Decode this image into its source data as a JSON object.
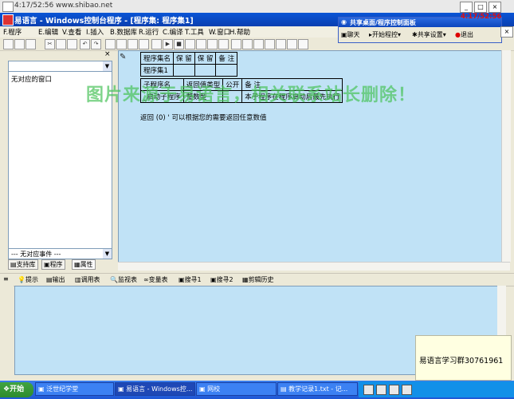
{
  "recorder": {
    "title": "4:17/52:56 www.shibao.net"
  },
  "window": {
    "title": "易语言 - Windows控制台程序 - [程序集: 程序集1]"
  },
  "menu": [
    "F.程序",
    "E.编辑",
    "V.查看",
    "I.插入",
    "B.数据库",
    "R.运行",
    "C.编译",
    "T.工具",
    "W.窗口",
    "H.帮助"
  ],
  "share_panel": {
    "title": "共享桌面/程序控制面板",
    "clock": "4:17/52:56",
    "buttons": [
      "聊天",
      "开始程控",
      "共享设置",
      "退出"
    ]
  },
  "left_panel": {
    "combo_value": "",
    "list_item": "无对应的窗口",
    "event_combo": "--- 无对应事件 ---",
    "tabs": [
      "支持库",
      "程序",
      "属性"
    ]
  },
  "editor": {
    "table1": {
      "headers": [
        "程序集名",
        "保 留",
        "保 留",
        "备 注"
      ],
      "row": [
        "程序集1",
        "",
        "",
        ""
      ]
    },
    "table2": {
      "headers": [
        "子程序名",
        "返回值类型",
        "公开",
        "备 注"
      ],
      "row": [
        "_启动子程序",
        "整数型",
        "",
        "本子程序在程序启动后最先执行"
      ]
    },
    "code_line": "返回 (0)  ' 可以根据您的需要返回任意数值"
  },
  "watermark": "图片来源于易语言，相关联系站长删除！",
  "bottom_tabs": [
    "提示",
    "输出",
    "调用表",
    "监视表",
    "变量表",
    "搜寻1",
    "搜寻2",
    "剪辑历史"
  ],
  "ad": {
    "text": "易语言学习群30761961"
  },
  "taskbar": {
    "start": "开始",
    "tasks": [
      "泛世纪学堂",
      "易语言 - Windows控...",
      "网校",
      "教学记录1.txt - 记..."
    ]
  }
}
